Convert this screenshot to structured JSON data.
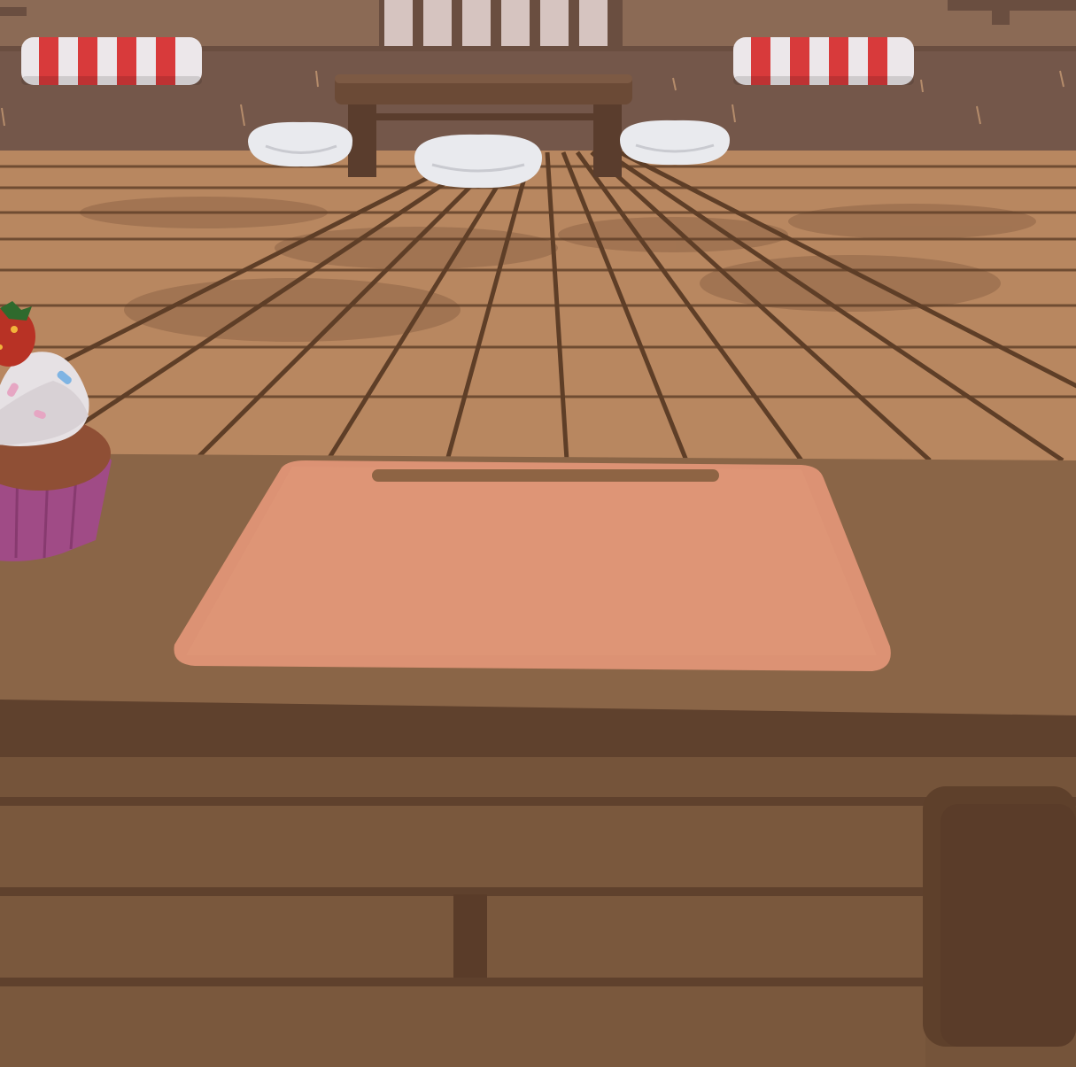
{
  "scene": {
    "type": "3d-game-viewport",
    "setting": "bakery-interior",
    "hud_text": []
  },
  "colors": {
    "back_wall": "#74574a",
    "wall_trim": "#8b6a55",
    "floor": "#b88760",
    "floor_seam": "#5e3e27",
    "floor_shadow": "#9d7150",
    "counter_top": "#8a6547",
    "counter_edge": "#5f412d",
    "counter_front": "#75543a",
    "cutting_board": "#dc9274",
    "board_slot": "#8e6444",
    "awning_red": "#d83a3b",
    "awning_white": "#ece7ea",
    "cushion": "#e9eaee",
    "table": "#6b4a36",
    "cupcake_liner": "#a04b86",
    "cupcake_cake": "#8f4f35",
    "frosting": "#e6e1e4",
    "strawberry": "#b83225",
    "sprinkle_pink": "#e6a6c3",
    "sprinkle_blue": "#7fb4e3",
    "sprinkle_yellow": "#f2b33a"
  },
  "objects": [
    {
      "name": "back-wall",
      "icon": "wall"
    },
    {
      "name": "window-blinds",
      "icon": "window"
    },
    {
      "name": "awning-left",
      "icon": "striped-awning"
    },
    {
      "name": "awning-right",
      "icon": "striped-awning"
    },
    {
      "name": "low-table",
      "icon": "table"
    },
    {
      "name": "cushion-left",
      "icon": "cushion"
    },
    {
      "name": "cushion-center",
      "icon": "cushion"
    },
    {
      "name": "cushion-right",
      "icon": "cushion"
    },
    {
      "name": "wooden-floor",
      "icon": "floor"
    },
    {
      "name": "counter-top",
      "icon": "counter"
    },
    {
      "name": "cutting-board",
      "icon": "cutting-board"
    },
    {
      "name": "cupcake",
      "icon": "cupcake"
    },
    {
      "name": "counter-drawers",
      "icon": "drawer"
    }
  ]
}
